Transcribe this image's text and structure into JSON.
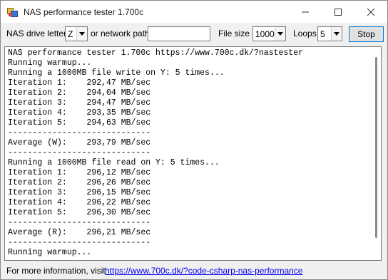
{
  "window": {
    "title": "NAS performance tester 1.700c"
  },
  "toolbar": {
    "drive_letter_label": "NAS drive letter",
    "drive_letter_value": "Z",
    "network_path_label": "or network path",
    "network_path_value": "",
    "file_size_label": "File size",
    "file_size_value": "1000",
    "loops_label": "Loops",
    "loops_value": "5",
    "stop_label": "Stop"
  },
  "output": {
    "lines": [
      "NAS performance tester 1.700c https://www.700c.dk/?nastester",
      "Running warmup...",
      "Running a 1000MB file write on Y: 5 times...",
      "Iteration 1:    292,47 MB/sec",
      "Iteration 2:    294,04 MB/sec",
      "Iteration 3:    294,47 MB/sec",
      "Iteration 4:    293,35 MB/sec",
      "Iteration 5:    294,63 MB/sec",
      "-----------------------------",
      "Average (W):    293,79 MB/sec",
      "-----------------------------",
      "Running a 1000MB file read on Y: 5 times...",
      "Iteration 1:    296,12 MB/sec",
      "Iteration 2:    296,26 MB/sec",
      "Iteration 3:    296,15 MB/sec",
      "Iteration 4:    296,22 MB/sec",
      "Iteration 5:    296,30 MB/sec",
      "-----------------------------",
      "Average (R):    296,21 MB/sec",
      "-----------------------------",
      "Running warmup..."
    ]
  },
  "status": {
    "info_label": "For more information, visit",
    "info_link": "https://www.700c.dk/?code-csharp-nas-performance"
  }
}
